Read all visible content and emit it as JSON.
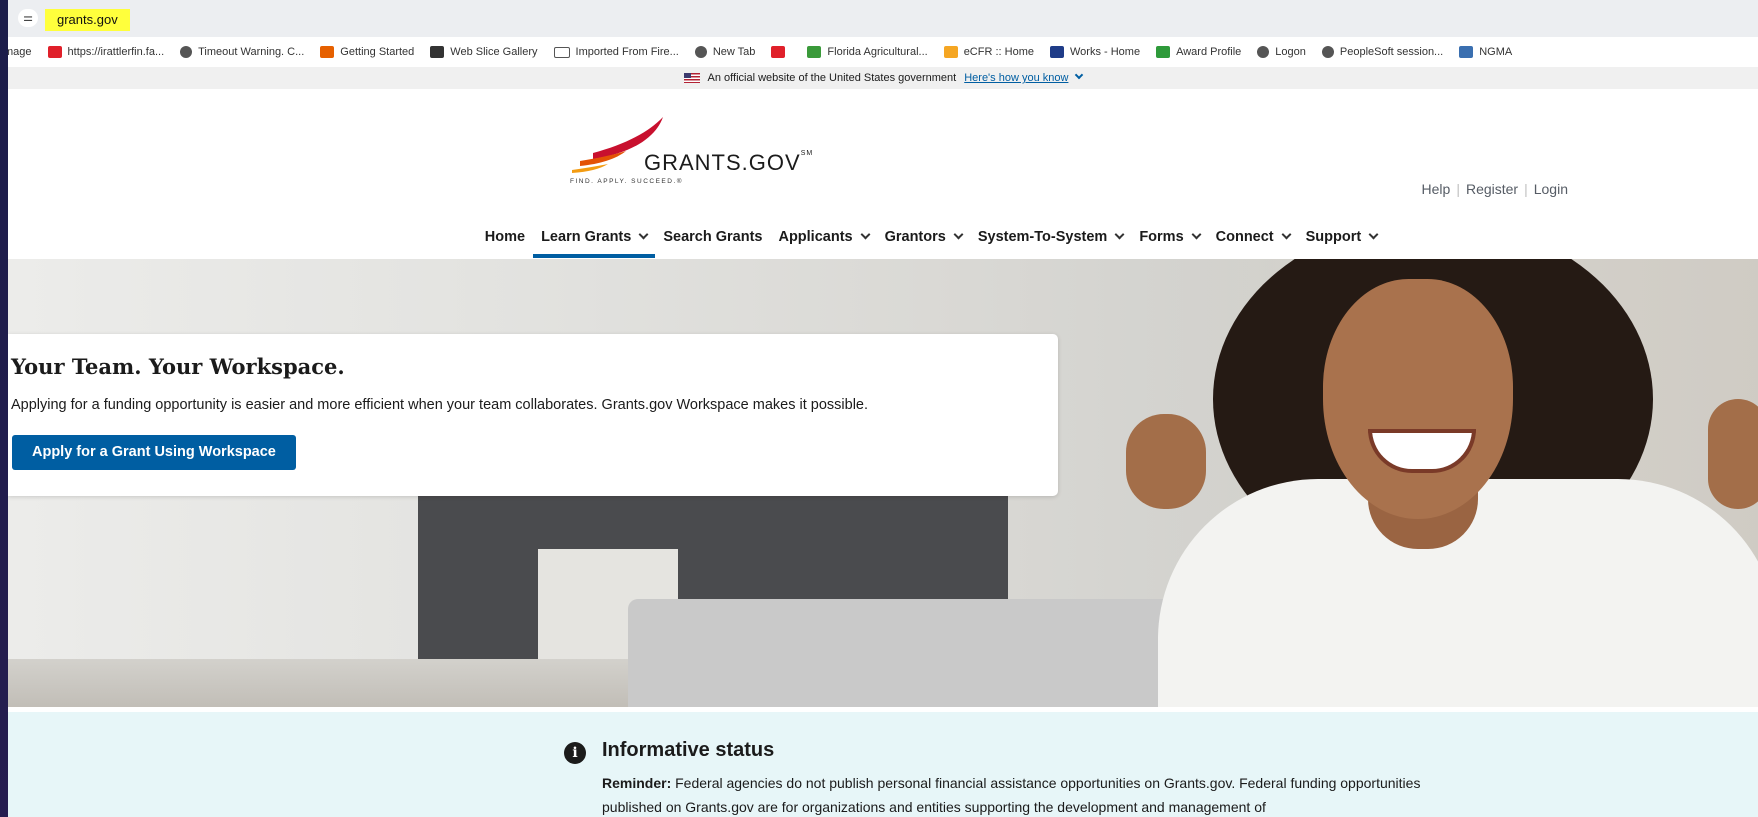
{
  "browser": {
    "url": "grants.gov",
    "site_icon": "site-settings-icon"
  },
  "bookmarks": [
    {
      "label": "mage",
      "icon": "none"
    },
    {
      "label": "https://irattlerfin.fa...",
      "icon": "red-bookmark-icon",
      "color": "#e0202a"
    },
    {
      "label": "Timeout Warning. C...",
      "icon": "globe-icon",
      "color": "#555555"
    },
    {
      "label": "Getting Started",
      "icon": "firefox-icon",
      "color": "#e66000"
    },
    {
      "label": "Web Slice Gallery",
      "icon": "ie-slice-icon",
      "color": "#333333"
    },
    {
      "label": "Imported From Fire...",
      "icon": "folder-icon",
      "color": "#555555"
    },
    {
      "label": "New Tab",
      "icon": "globe-icon",
      "color": "#555555"
    },
    {
      "label": "",
      "icon": "red-bookmark-icon",
      "color": "#e0202a"
    },
    {
      "label": "Florida Agricultural...",
      "icon": "famu-icon",
      "color": "#3a9a3a"
    },
    {
      "label": "eCFR :: Home",
      "icon": "ecfr-icon",
      "color": "#f5a623"
    },
    {
      "label": "Works - Home",
      "icon": "works-icon",
      "color": "#1f3c88"
    },
    {
      "label": "Award Profile",
      "icon": "award-icon",
      "color": "#2e9a3a"
    },
    {
      "label": "Logon",
      "icon": "globe-icon",
      "color": "#555555"
    },
    {
      "label": "PeopleSoft session...",
      "icon": "globe-icon",
      "color": "#555555"
    },
    {
      "label": "NGMA",
      "icon": "ngma-icon",
      "color": "#3a6fb0"
    }
  ],
  "gov_banner": {
    "text": "An official website of the United States government",
    "link": "Here's how you know"
  },
  "header": {
    "logo_text": "GRANTS.GOV",
    "logo_mark": "SM",
    "tagline": "FIND. APPLY. SUCCEED.®",
    "util_links": [
      "Help",
      "Register",
      "Login"
    ]
  },
  "nav": [
    {
      "label": "Home",
      "dropdown": false,
      "active": false
    },
    {
      "label": "Learn Grants",
      "dropdown": true,
      "active": true
    },
    {
      "label": "Search Grants",
      "dropdown": false,
      "active": false
    },
    {
      "label": "Applicants",
      "dropdown": true,
      "active": false
    },
    {
      "label": "Grantors",
      "dropdown": true,
      "active": false
    },
    {
      "label": "System-To-System",
      "dropdown": true,
      "active": false
    },
    {
      "label": "Forms",
      "dropdown": true,
      "active": false
    },
    {
      "label": "Connect",
      "dropdown": true,
      "active": false
    },
    {
      "label": "Support",
      "dropdown": true,
      "active": false
    }
  ],
  "hero": {
    "title": "Your Team. Your Workspace.",
    "text": "Applying for a funding opportunity is easier and more efficient when your team collaborates. Grants.gov Workspace makes it possible.",
    "button": "Apply for a Grant Using Workspace"
  },
  "info": {
    "title": "Informative status",
    "reminder_label": "Reminder:",
    "reminder_text": "Federal agencies do not publish personal financial assistance opportunities on Grants.gov. Federal funding opportunities published on Grants.gov are for organizations and entities supporting the development and management of"
  },
  "colors": {
    "accent": "#005ea2",
    "highlight": "#ffff3c",
    "info_bg": "#e7f6f8"
  }
}
